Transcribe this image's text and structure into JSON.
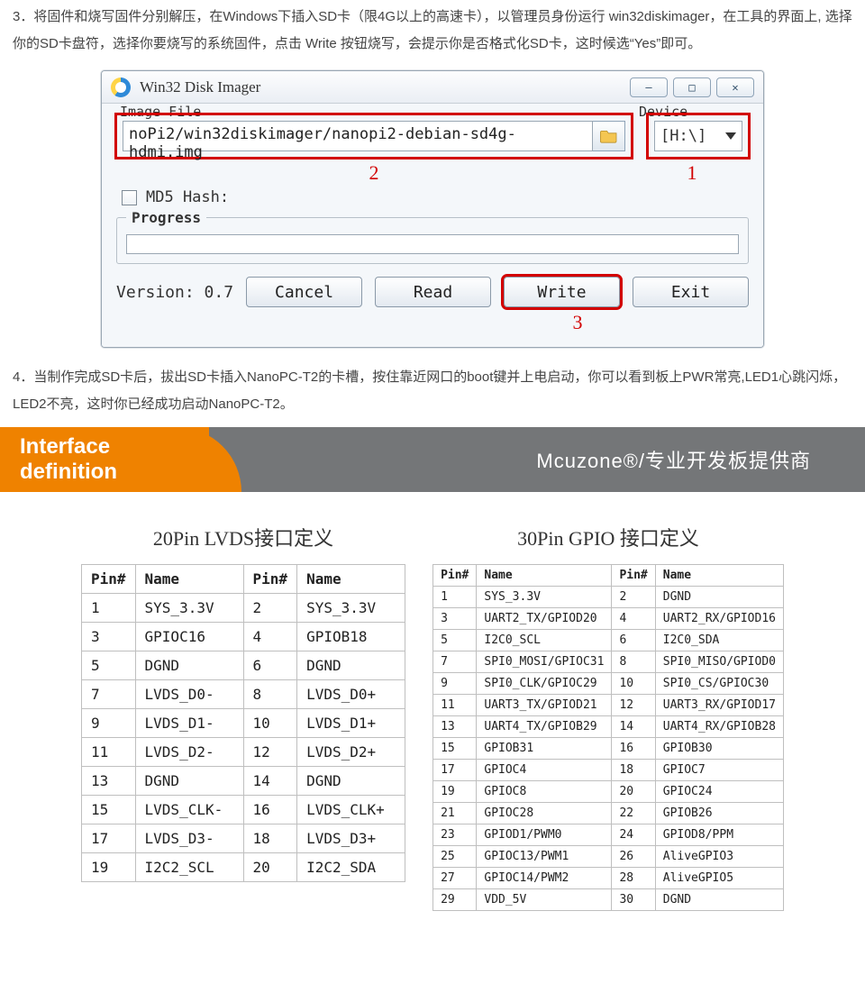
{
  "step3": "3．将固件和烧写固件分别解压，在Windows下插入SD卡（限4G以上的高速卡），以管理员身份运行 win32diskimager，在工具的界面上, 选择你的SD卡盘符，选择你要烧写的系统固件，点击 Write 按钮烧写，会提示你是否格式化SD卡，这时候选“Yes”即可。",
  "step4": "4．当制作完成SD卡后，拔出SD卡插入NanoPC-T2的卡槽，按住靠近网口的boot键并上电启动，你可以看到板上PWR常亮,LED1心跳闪烁，LED2不亮，这时你已经成功启动NanoPC-T2。",
  "win32": {
    "title": "Win32 Disk Imager",
    "label_image": "Image File",
    "label_device": "Device",
    "path": "noPi2/win32diskimager/nanopi2-debian-sd4g-hdmi.img",
    "drive": "[H:\\]",
    "md5": "MD5 Hash:",
    "progress": "Progress",
    "version": "Version: 0.7",
    "btn_cancel": "Cancel",
    "btn_read": "Read",
    "btn_write": "Write",
    "btn_exit": "Exit",
    "num1": "1",
    "num2": "2",
    "num3": "3",
    "winmin": "—",
    "winmax": "□",
    "winclose": "✕"
  },
  "banner": {
    "left1": "Interface",
    "left2": "definition",
    "right": "Mcuzone®/专业开发板提供商"
  },
  "lvds": {
    "caption": "20Pin LVDS接口定义",
    "headers": [
      "Pin#",
      "Name",
      "Pin#",
      "Name"
    ],
    "rows": [
      [
        "1",
        "SYS_3.3V",
        "2",
        "SYS_3.3V"
      ],
      [
        "3",
        "GPIOC16",
        "4",
        "GPIOB18"
      ],
      [
        "5",
        "DGND",
        "6",
        "DGND"
      ],
      [
        "7",
        "LVDS_D0-",
        "8",
        "LVDS_D0+"
      ],
      [
        "9",
        "LVDS_D1-",
        "10",
        "LVDS_D1+"
      ],
      [
        "11",
        "LVDS_D2-",
        "12",
        "LVDS_D2+"
      ],
      [
        "13",
        "DGND",
        "14",
        "DGND"
      ],
      [
        "15",
        "LVDS_CLK-",
        "16",
        "LVDS_CLK+"
      ],
      [
        "17",
        "LVDS_D3-",
        "18",
        "LVDS_D3+"
      ],
      [
        "19",
        "I2C2_SCL",
        "20",
        "I2C2_SDA"
      ]
    ]
  },
  "gpio": {
    "caption": "30Pin GPIO 接口定义",
    "headers": [
      "Pin#",
      "Name",
      "Pin#",
      "Name"
    ],
    "rows": [
      [
        "1",
        "SYS_3.3V",
        "2",
        "DGND"
      ],
      [
        "3",
        "UART2_TX/GPIOD20",
        "4",
        "UART2_RX/GPIOD16"
      ],
      [
        "5",
        "I2C0_SCL",
        "6",
        "I2C0_SDA"
      ],
      [
        "7",
        "SPI0_MOSI/GPIOC31",
        "8",
        "SPI0_MISO/GPIOD0"
      ],
      [
        "9",
        "SPI0_CLK/GPIOC29",
        "10",
        "SPI0_CS/GPIOC30"
      ],
      [
        "11",
        "UART3_TX/GPIOD21",
        "12",
        "UART3_RX/GPIOD17"
      ],
      [
        "13",
        "UART4_TX/GPIOB29",
        "14",
        "UART4_RX/GPIOB28"
      ],
      [
        "15",
        "GPIOB31",
        "16",
        "GPIOB30"
      ],
      [
        "17",
        "GPIOC4",
        "18",
        "GPIOC7"
      ],
      [
        "19",
        "GPIOC8",
        "20",
        "GPIOC24"
      ],
      [
        "21",
        "GPIOC28",
        "22",
        "GPIOB26"
      ],
      [
        "23",
        "GPIOD1/PWM0",
        "24",
        "GPIOD8/PPM"
      ],
      [
        "25",
        "GPIOC13/PWM1",
        "26",
        "AliveGPIO3"
      ],
      [
        "27",
        "GPIOC14/PWM2",
        "28",
        "AliveGPIO5"
      ],
      [
        "29",
        "VDD_5V",
        "30",
        "DGND"
      ]
    ]
  }
}
